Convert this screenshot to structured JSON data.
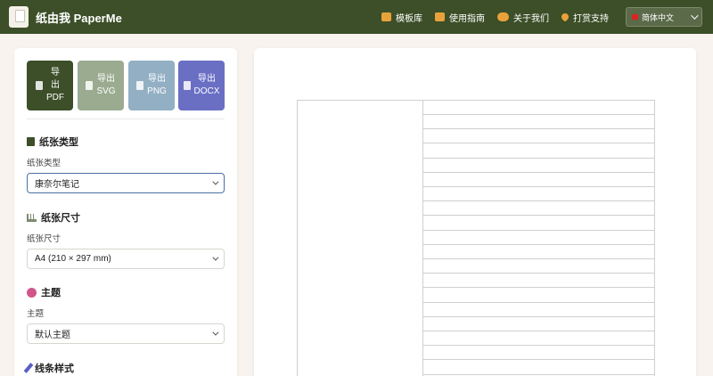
{
  "app": {
    "title": "纸由我 PaperMe",
    "logo_icon": "paper-sheet-icon"
  },
  "nav": [
    {
      "label": "模板库",
      "icon": "grid-icon",
      "color": "#e9a23b"
    },
    {
      "label": "使用指南",
      "icon": "book-icon",
      "color": "#e9a23b"
    },
    {
      "label": "关于我们",
      "icon": "users-icon",
      "color": "#e9a23b"
    },
    {
      "label": "打赏支持",
      "icon": "heart-icon",
      "color": "#e9a23b"
    }
  ],
  "language": {
    "label": "简体中文",
    "flag_icon": "china-flag-icon"
  },
  "export_buttons": [
    {
      "label": "导\n出\nPDF",
      "color": "#3c4f28"
    },
    {
      "label": "导出\nSVG",
      "color": "#9aab8f"
    },
    {
      "label": "导出\nPNG",
      "color": "#92afc4"
    },
    {
      "label": "导出\nDOCX",
      "color": "#6a6fc4"
    }
  ],
  "paper_type": {
    "title": "纸张类型",
    "label": "纸张类型",
    "value": "康奈尔笔记",
    "icon": "file-icon",
    "icon_color": "#3c4f28"
  },
  "paper_size": {
    "title": "纸张尺寸",
    "label": "纸张尺寸",
    "value": "A4 (210 × 297 mm)",
    "icon": "ruler-icon",
    "icon_color": "#7c8a6e"
  },
  "theme": {
    "title": "主题",
    "label": "主题",
    "value": "默认主题",
    "icon": "palette-icon",
    "icon_color": "#d0568a"
  },
  "line_style": {
    "title": "线条样式",
    "icon": "pencil-icon",
    "icon_color": "#5a5fc4"
  }
}
